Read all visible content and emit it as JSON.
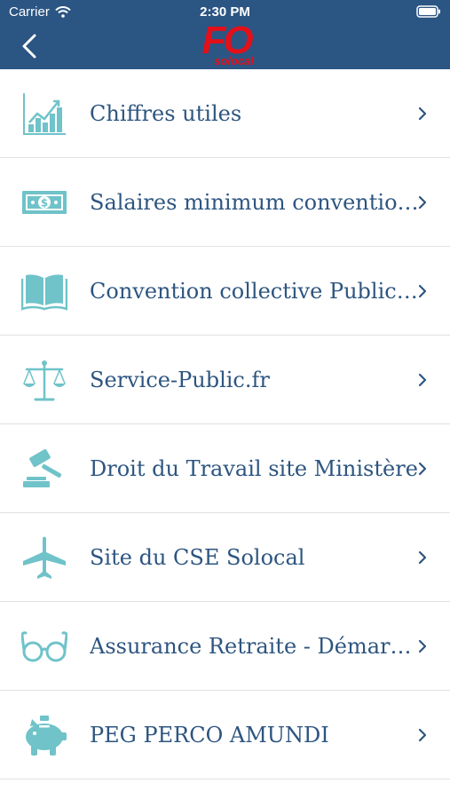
{
  "status_bar": {
    "carrier": "Carrier",
    "time": "2:30 PM"
  },
  "header": {
    "logo_main": "FO",
    "logo_sub": "solocal",
    "background_color": "#2b5583"
  },
  "colors": {
    "icon": "#6fc3c9",
    "label": "#2d5580",
    "chevron": "#2d5580",
    "divider": "#e1e1e1",
    "logo": "#e3101a"
  },
  "items": [
    {
      "label": "Chiffres utiles",
      "icon": "chart-up-icon"
    },
    {
      "label": "Salaires minimum conventionnels",
      "icon": "banknote-icon"
    },
    {
      "label": "Convention collective Publicité",
      "icon": "open-book-icon"
    },
    {
      "label": "Service-Public.fr",
      "icon": "balance-scale-icon"
    },
    {
      "label": "Droit du Travail site Ministère",
      "icon": "gavel-icon"
    },
    {
      "label": "Site du CSE Solocal",
      "icon": "airplane-icon"
    },
    {
      "label": "Assurance Retraite - Démarches",
      "icon": "glasses-icon"
    },
    {
      "label": "PEG PERCO AMUNDI",
      "icon": "piggy-bank-icon"
    }
  ]
}
